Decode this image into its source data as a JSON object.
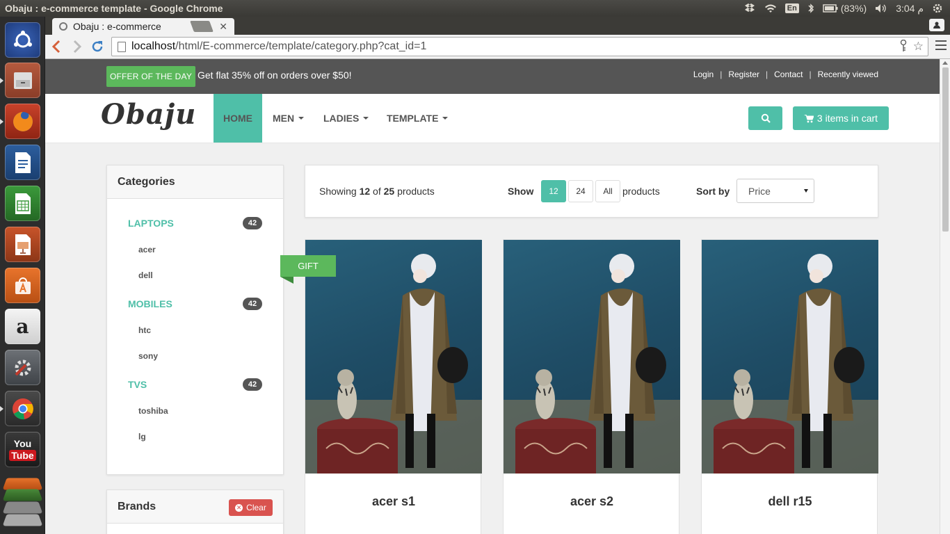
{
  "os": {
    "window_title": "Obaju : e-commerce template - Google Chrome",
    "language": "En",
    "battery": "(83%)",
    "time": "3:04 م"
  },
  "launcher": {
    "items": [
      "dash-home",
      "files",
      "firefox",
      "writer",
      "calc",
      "impress",
      "software-center",
      "amazon",
      "system-settings",
      "chrome",
      "youtube",
      "workspace-stack"
    ]
  },
  "browser": {
    "tab_title": "Obaju : e-commerce",
    "url_host": "localhost",
    "url_path": "/html/E-commerce/template/category.php?cat_id=1"
  },
  "topbar": {
    "offer_label": "OFFER OF THE DAY",
    "offer_text": "Get flat 35% off on orders over $50!",
    "links": [
      "Login",
      "Register",
      "Contact",
      "Recently viewed"
    ]
  },
  "nav": {
    "logo": "Obaju",
    "items": [
      "HOME",
      "MEN",
      "LADIES",
      "TEMPLATE"
    ],
    "cart_label": "3 items in cart"
  },
  "categories": {
    "title": "Categories",
    "groups": [
      {
        "name": "LAPTOPS",
        "count": "42",
        "subs": [
          "acer",
          "dell"
        ]
      },
      {
        "name": "MOBILES",
        "count": "42",
        "subs": [
          "htc",
          "sony"
        ]
      },
      {
        "name": "TVS",
        "count": "42",
        "subs": [
          "toshiba",
          "lg"
        ]
      }
    ]
  },
  "brands": {
    "title": "Brands",
    "clear_label": "Clear"
  },
  "listing": {
    "showing_prefix": "Showing ",
    "showing_count": "12",
    "showing_of": " of ",
    "showing_total": "25",
    "showing_suffix": " products",
    "show_label": "Show",
    "page_sizes": [
      "12",
      "24",
      "All"
    ],
    "products_label": "products",
    "sort_label": "Sort by",
    "sort_value": "Price"
  },
  "gift_ribbon": "GIFT",
  "products": [
    {
      "name": "acer s1"
    },
    {
      "name": "acer s2"
    },
    {
      "name": "dell r15"
    }
  ],
  "colors": {
    "accent": "#4fbfa8",
    "offer_green": "#5cb85c",
    "topbar": "#555555",
    "clear_red": "#d9534f"
  }
}
